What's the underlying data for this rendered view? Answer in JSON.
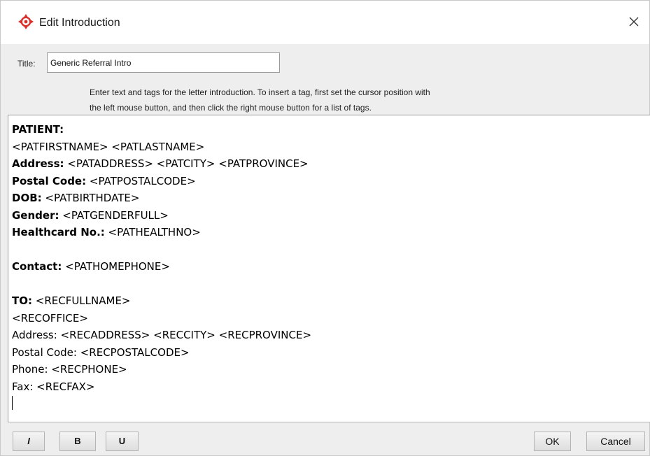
{
  "window": {
    "title": "Edit Introduction",
    "close_glyph": "✕",
    "icon": "target-icon",
    "icon_color": "#d9302c"
  },
  "form": {
    "title_label": "Title:",
    "title_value": "Generic Referral Intro",
    "instructions_line1": "Enter text and tags for the letter introduction. To insert a tag, first set the cursor position with",
    "instructions_line2": "the left mouse button, and then click the right mouse button for a list of tags."
  },
  "editor": {
    "lines": [
      {
        "bold": "PATIENT:",
        "text": ""
      },
      {
        "bold": "",
        "text": "<PATFIRSTNAME> <PATLASTNAME>"
      },
      {
        "bold": "Address:",
        "text": " <PATADDRESS> <PATCITY> <PATPROVINCE>"
      },
      {
        "bold": "Postal Code:",
        "text": " <PATPOSTALCODE>"
      },
      {
        "bold": "DOB:",
        "text": " <PATBIRTHDATE>"
      },
      {
        "bold": "Gender:",
        "text": " <PATGENDERFULL>"
      },
      {
        "bold": "Healthcard No.:",
        "text": " <PATHEALTHNO>"
      },
      {
        "bold": "",
        "text": ""
      },
      {
        "bold": "Contact:",
        "text": " <PATHOMEPHONE>"
      },
      {
        "bold": "",
        "text": ""
      },
      {
        "bold": "TO:",
        "text": " <RECFULLNAME>"
      },
      {
        "bold": "",
        "text": "<RECOFFICE>"
      },
      {
        "bold": "",
        "text": "Address: <RECADDRESS> <RECCITY> <RECPROVINCE>"
      },
      {
        "bold": "",
        "text": "Postal Code: <RECPOSTALCODE>"
      },
      {
        "bold": "",
        "text": "Phone: <RECPHONE>"
      },
      {
        "bold": "",
        "text": "Fax: <RECFAX>"
      }
    ]
  },
  "toolbar": {
    "italic_label": "I",
    "bold_label": "B",
    "underline_label": "U",
    "ok_label": "OK",
    "cancel_label": "Cancel"
  }
}
